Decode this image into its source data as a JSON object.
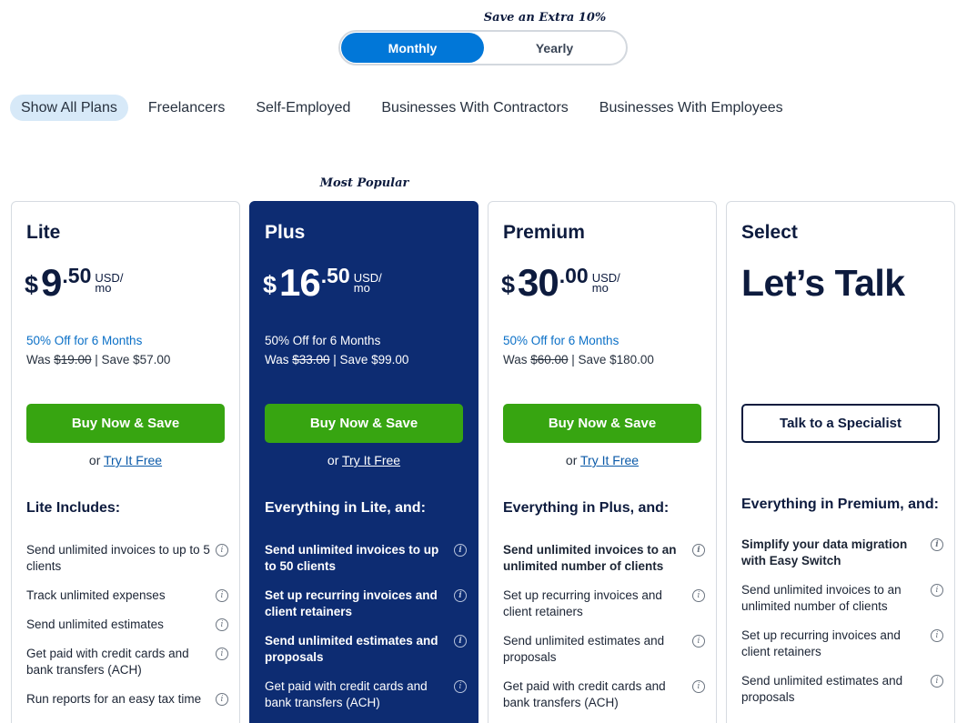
{
  "billing": {
    "save_note": "Save an Extra 10%",
    "monthly_label": "Monthly",
    "yearly_label": "Yearly"
  },
  "filters": [
    "Show All Plans",
    "Freelancers",
    "Self-Employed",
    "Businesses With Contractors",
    "Businesses With Employees"
  ],
  "most_popular": "Most Popular",
  "info_glyph": "i",
  "plans": [
    {
      "name": "Lite",
      "currency": "$",
      "price_whole": "9",
      "price_cents": ".50",
      "unit_line1": "USD/",
      "unit_line2": "mo",
      "discount": "50% Off for 6 Months",
      "was_prefix": "Was ",
      "was_price": "$19.00",
      "save_text": " | Save $57.00",
      "cta": "Buy Now & Save",
      "or_text": "or ",
      "try_link": "Try It Free",
      "includes_title": "Lite Includes:",
      "features": [
        "Send unlimited invoices to up to 5 clients",
        "Track unlimited expenses",
        "Send unlimited estimates",
        "Get paid with credit cards and bank transfers (ACH)",
        "Run reports for an easy tax time"
      ]
    },
    {
      "name": "Plus",
      "currency": "$",
      "price_whole": "16",
      "price_cents": ".50",
      "unit_line1": "USD/",
      "unit_line2": "mo",
      "discount": "50% Off for 6 Months",
      "was_prefix": "Was ",
      "was_price": "$33.00",
      "save_text": " | Save $99.00",
      "cta": "Buy Now & Save",
      "or_text": "or ",
      "try_link": "Try It Free",
      "includes_title": "Everything in Lite, and:",
      "features": [
        "Send unlimited invoices to up to 50 clients",
        "Set up recurring invoices and client retainers",
        "Send unlimited estimates and proposals",
        "Get paid with credit cards and bank transfers (ACH)"
      ]
    },
    {
      "name": "Premium",
      "currency": "$",
      "price_whole": "30",
      "price_cents": ".00",
      "unit_line1": "USD/",
      "unit_line2": "mo",
      "discount": "50% Off for 6 Months",
      "was_prefix": "Was ",
      "was_price": "$60.00",
      "save_text": " | Save $180.00",
      "cta": "Buy Now & Save",
      "or_text": "or ",
      "try_link": "Try It Free",
      "includes_title": "Everything in Plus, and:",
      "features": [
        "Send unlimited invoices to an unlimited number of clients",
        "Set up recurring invoices and client retainers",
        "Send unlimited estimates and proposals",
        "Get paid with credit cards and bank transfers (ACH)"
      ]
    },
    {
      "name": "Select",
      "headline": "Let’s Talk",
      "cta": "Talk to a Specialist",
      "includes_title": "Everything in Premium, and:",
      "features": [
        "Simplify your data migration with Easy Switch",
        "Send unlimited invoices to an unlimited number of clients",
        "Set up recurring invoices and client retainers",
        "Send unlimited estimates and proposals"
      ]
    }
  ],
  "colors": {
    "toggle_active": "#0177d8",
    "featured_bg": "#0d2c72",
    "cta_green": "#37a511",
    "discount_blue": "#0b70c7",
    "filter_active_bg": "#d7e9f8"
  }
}
